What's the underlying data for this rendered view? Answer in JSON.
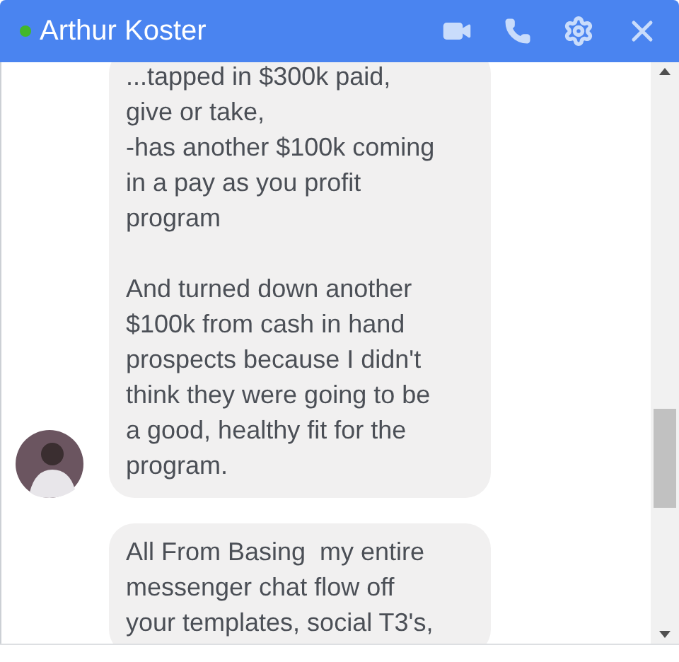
{
  "header": {
    "name": "Arthur Koster",
    "online": true
  },
  "messages": [
    {
      "text": "...tapped in $300k paid,\ngive or take,\n-has another $100k coming\nin a pay as you profit\nprogram\n\nAnd turned down another\n$100k from cash in hand\nprospects because I didn't\nthink they were going to be\na good, healthy fit for the\nprogram.",
      "avatar": true
    },
    {
      "text": "All From Basing  my entire\nmessenger chat flow off\nyour templates, social T3's,",
      "avatar": false
    }
  ]
}
